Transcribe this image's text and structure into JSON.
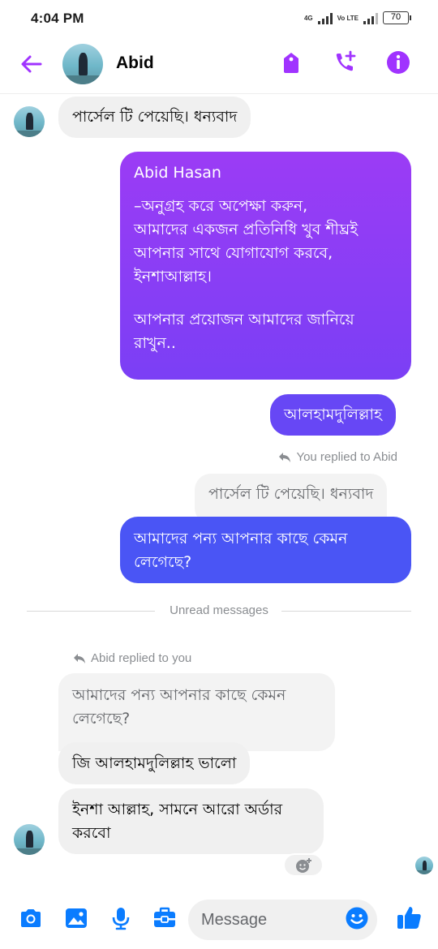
{
  "status_bar": {
    "time": "4:04 PM",
    "network": "4G",
    "volte": "Vo LTE",
    "battery": "70"
  },
  "header": {
    "contact_name": "Abid"
  },
  "messages": {
    "m1": "পার্সেল টি পেয়েছি। ধন্যবাদ",
    "m2_sender": "Abid Hasan",
    "m2_line1": "–অনুগ্রহ করে অপেক্ষা করুন,",
    "m2_line2": "আমাদের একজন প্রতিনিধি খুব শীঘ্রই",
    "m2_line3": "আপনার সাথে যোগাযোগ করবে,",
    "m2_line4": "ইনশাআল্লাহ।",
    "m2_line5": "আপনার প্রয়োজন আমাদের জানিয়ে",
    "m2_line6": "রাখুন..",
    "m3": "আলহামদুলিল্লাহ",
    "reply1_label": "You replied to Abid",
    "reply1_quote": "পার্সেল টি পেয়েছি। ধন্যবাদ",
    "m4_line1": "আমাদের পন্য আপনার কাছে কেমন",
    "m4_line2": "লেগেছে?",
    "unread_label": "Unread messages",
    "reply2_label": "Abid replied to you",
    "reply2_quote_line1": "আমাদের পন্য আপনার কাছে কেমন",
    "reply2_quote_line2": "লেগেছে?",
    "m5": "জি আলহামদুলিল্লাহ ভালো",
    "m6_line1": "ইনশা আল্লাহ, সামনে আরো অর্ডার",
    "m6_line2": "করবো"
  },
  "composer": {
    "placeholder": "Message"
  },
  "colors": {
    "accent": "#a033ff",
    "bubble_purple_top": "#9b3cf5",
    "bubble_purple_bottom": "#7b3ff5",
    "bubble_blue": "#4a55f5",
    "composer_blue": "#0a7cff"
  },
  "icons": [
    "back-arrow-icon",
    "tag-icon",
    "add-call-icon",
    "info-icon",
    "reply-icon",
    "add-reaction-icon",
    "camera-icon",
    "gallery-icon",
    "microphone-icon",
    "toolbox-icon",
    "emoji-icon",
    "thumbs-up-icon"
  ]
}
